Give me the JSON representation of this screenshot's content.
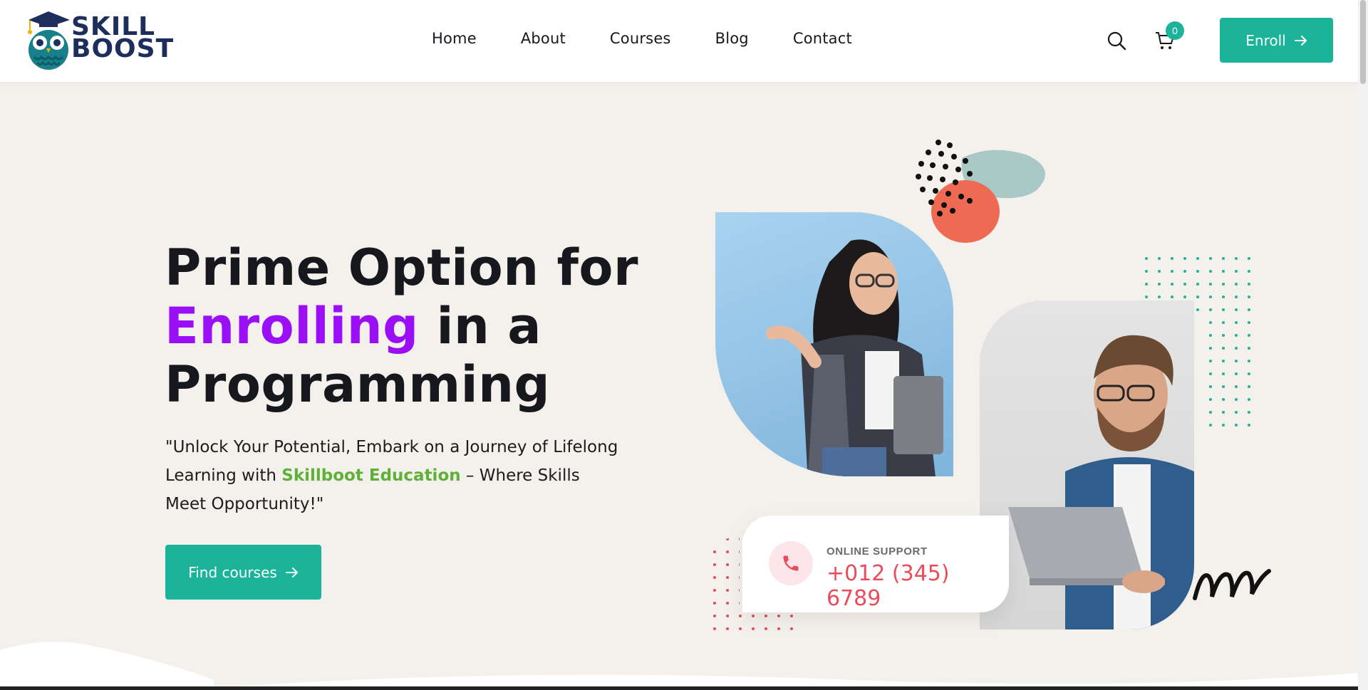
{
  "brand": {
    "line1": "SKILL",
    "line2": "BOOST"
  },
  "nav": {
    "items": [
      {
        "label": "Home"
      },
      {
        "label": "About"
      },
      {
        "label": "Courses"
      },
      {
        "label": "Blog"
      },
      {
        "label": "Contact"
      }
    ]
  },
  "header": {
    "cart_count": "0",
    "enroll_label": "Enroll"
  },
  "hero": {
    "title_line1": "Prime Option for",
    "title_accent": "Enrolling",
    "title_line2_rest": " in a",
    "title_line3": "Programming",
    "desc_part1": "\"Unlock Your Potential, Embark on a Journey of Lifelong Learning with ",
    "desc_brand": "Skillboot Education",
    "desc_part2": " – Where Skills Meet Opportunity!\"",
    "cta_label": "Find courses"
  },
  "support": {
    "label": "ONLINE SUPPORT",
    "phone": "+012 (345) 6789"
  },
  "colors": {
    "primary": "#1bb399",
    "accent_purple": "#9a0ff5",
    "brand_green": "#5fb039",
    "phone_red": "#ea4c5c",
    "background": "#f4f1ec"
  }
}
